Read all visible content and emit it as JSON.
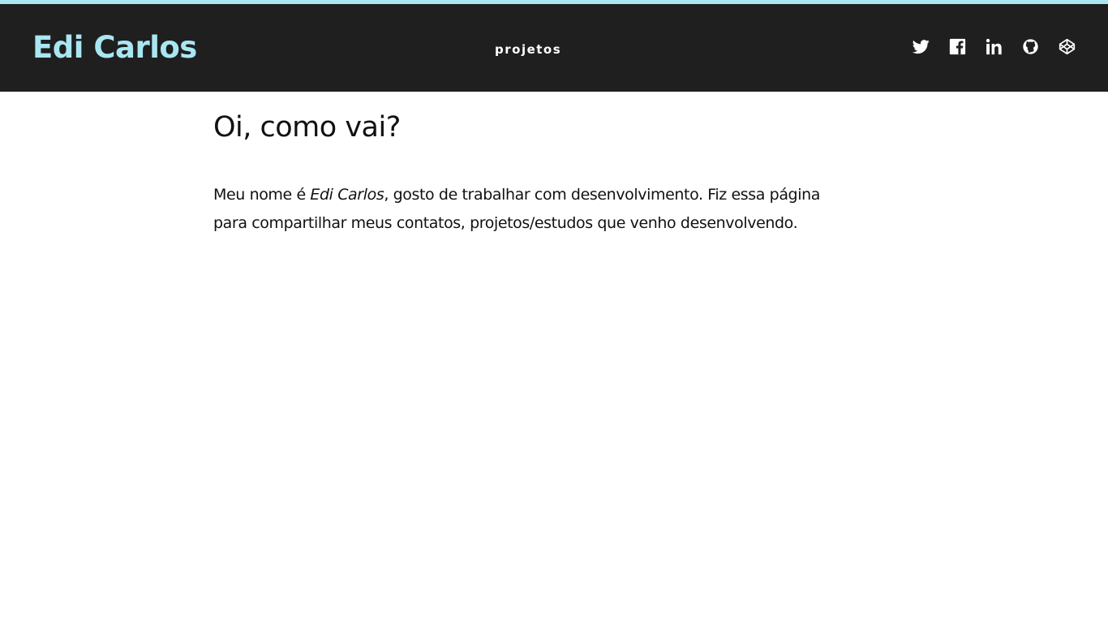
{
  "header": {
    "brand": "Edi Carlos",
    "nav_label": "projetos",
    "social_icons": [
      "twitter-icon",
      "facebook-icon",
      "linkedin-icon",
      "github-icon",
      "codepen-icon"
    ]
  },
  "main": {
    "title": "Oi, como vai?",
    "intro_prefix": "Meu nome é ",
    "intro_name": "Edi Carlos",
    "intro_suffix": ", gosto de trabalhar com desenvolvimento. Fiz essa página para compartilhar meus contatos, projetos/estudos que venho desenvolvendo."
  },
  "colors": {
    "accent": "#a9e6f2",
    "header_bg": "#1f1f1f",
    "background": "#ffffff",
    "text": "#111111"
  }
}
